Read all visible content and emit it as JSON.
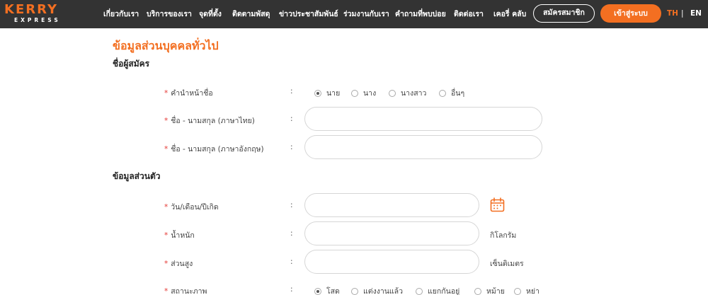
{
  "header": {
    "logo_main": "KERRY",
    "logo_sub": "EXPRESS",
    "nav": [
      "เกี่ยวกับเรา",
      "บริการของเรา",
      "จุดที่ตั้ง",
      "ติดตามพัสดุ",
      "ข่าวประชาสัมพันธ์",
      "ร่วมงานกับเรา",
      "คำถามที่พบบ่อย",
      "ติดต่อเรา",
      "เคอรี่ คลับ"
    ],
    "register_label": "สมัครสมาชิก",
    "login_label": "เข้าสู่ระบบ",
    "lang_th": "TH",
    "lang_sep": "|",
    "lang_en": "EN",
    "accent_color": "#f36f21"
  },
  "form": {
    "page_title": "ข้อมูลส่วนบุคคลทั่วไป",
    "section_name": "ชื่อผู้สมัคร",
    "section_personal": "ข้อมูลส่วนตัว",
    "required_mark": "*",
    "colon": ":",
    "title_label": "คำนำหน้าชื่อ",
    "title_options": [
      "นาย",
      "นาง",
      "นางสาว",
      "อื่นๆ"
    ],
    "title_selected": "นาย",
    "name_th_label": "ชื่อ - นามสกุล (ภาษาไทย)",
    "name_th_value": "",
    "name_en_label": "ชื่อ - นามสกุล (ภาษาอังกฤษ)",
    "name_en_value": "",
    "dob_label": "วัน/เดือน/ปีเกิด",
    "dob_value": "",
    "dob_icon": "calendar-icon",
    "weight_label": "น้ำหนัก",
    "weight_value": "",
    "weight_unit": "กิโลกรัม",
    "height_label": "ส่วนสูง",
    "height_value": "",
    "height_unit": "เซ็นติเมตร",
    "status_label": "สถานะภาพ",
    "status_options": [
      "โสด",
      "แต่งงานแล้ว",
      "แยกกันอยู่",
      "หม้าย",
      "หย่า"
    ],
    "status_selected": "โสด"
  }
}
